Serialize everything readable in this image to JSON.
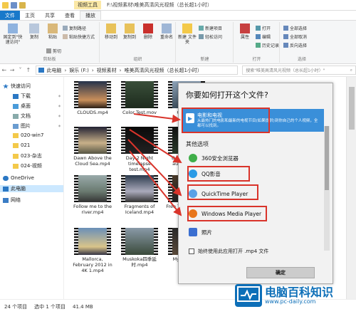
{
  "titlebar": {
    "tool_tag": "视频工具",
    "title": "F:\\视频素材\\唯美高清风光视频（总长超1小时）"
  },
  "tabs": [
    {
      "label": "文件"
    },
    {
      "label": "主页"
    },
    {
      "label": "共享"
    },
    {
      "label": "查看"
    },
    {
      "label": "播放"
    }
  ],
  "ribbon": {
    "pin_quick": "固定到\"快速访问\"",
    "copy": "复制",
    "paste": "粘贴",
    "copy_path": "复制路径",
    "paste_shortcut": "粘贴快捷方式",
    "cut": "剪切",
    "clipboard_label": "剪贴板",
    "move_to": "移动到",
    "copy_to": "复制到",
    "delete": "删除",
    "rename": "重命名",
    "organize_label": "组织",
    "new_folder": "新建\n文件夹",
    "new_item": "新建项目",
    "easy_access": "轻松访问",
    "new_label": "新建",
    "properties": "属性",
    "open": "打开",
    "edit": "编辑",
    "history": "历史记录",
    "open_label": "打开",
    "select_all": "全部选择",
    "select_none": "全部取消",
    "invert": "反向选择",
    "select_label": "选择"
  },
  "address": {
    "path": [
      "此电脑",
      "娱乐 (F:)",
      "视频素材",
      "唯美高清风光视频（总长超1小时）"
    ],
    "search_placeholder": "搜索\"唯美高清风光视频（总长超1小时）\""
  },
  "nav": {
    "items": [
      {
        "label": "快速访问",
        "icon": "star-icon"
      },
      {
        "label": "下载",
        "icon": "download-icon"
      },
      {
        "label": "桌面",
        "icon": "desktop-icon"
      },
      {
        "label": "文档",
        "icon": "document-icon"
      },
      {
        "label": "图片",
        "icon": "picture-icon"
      },
      {
        "label": "020-win7",
        "icon": "folder-icon"
      },
      {
        "label": "021",
        "icon": "folder-icon"
      },
      {
        "label": "023-杂志",
        "icon": "folder-icon"
      },
      {
        "label": "024-视频",
        "icon": "folder-icon"
      },
      {
        "label": "OneDrive",
        "icon": "cloud-icon"
      },
      {
        "label": "此电脑",
        "icon": "computer-icon"
      },
      {
        "label": "网络",
        "icon": "network-icon"
      }
    ]
  },
  "files": [
    {
      "name": "CLOUDS.mp4"
    },
    {
      "name": "Color Test.mov"
    },
    {
      "name": "Coque..."
    },
    {
      "name": "Dawn Above the Cloud Sea.mp4"
    },
    {
      "name": "Day 2 Night timelapse test.mp4"
    },
    {
      "name": "Degik jour et autre Vide..."
    },
    {
      "name": "Follow me to the river.mp4"
    },
    {
      "name": "Fragments of Iceland.mp4"
    },
    {
      "name": "Free Ti... sunset..."
    },
    {
      "name": "Mallorca, February 2012 in 4K 1.mp4"
    },
    {
      "name": "Muskoka四季延时.mp4"
    },
    {
      "name": "My... Gard..."
    }
  ],
  "status": {
    "count": "24 个项目",
    "selected": "选中 1 个项目",
    "size": "41.4 MB"
  },
  "dialog": {
    "title": "你要如何打开这个文件?",
    "recommended": {
      "name": "电影和电视",
      "desc": "从最热门的电影和最新的电视节目(如果提供)到你自己的个人视频，全都可以找到。"
    },
    "other_label": "其他选项",
    "apps": [
      {
        "name": "360安全浏览器",
        "icon": "360-browser-icon",
        "color": "#3fae49"
      },
      {
        "name": "QQ影音",
        "icon": "qq-player-icon",
        "color": "#2a9be6"
      },
      {
        "name": "QuickTime Player",
        "icon": "quicktime-icon",
        "color": "#5aa0e6"
      },
      {
        "name": "Windows Media Player",
        "icon": "wmp-icon",
        "color": "#e8761c"
      },
      {
        "name": "照片",
        "icon": "photos-icon",
        "color": "#3b6fd1"
      }
    ],
    "always_use": "始终使用此应用打开 .mp4 文件",
    "ok": "确定"
  },
  "watermark": {
    "main": "电脑百科知识",
    "sub": "www.pc-daily.com"
  },
  "colors": {
    "accent": "#1979ca",
    "highlight_box": "#d9342b",
    "arrow": "#d9342b",
    "recommended_bg": "#3a8fd9"
  }
}
